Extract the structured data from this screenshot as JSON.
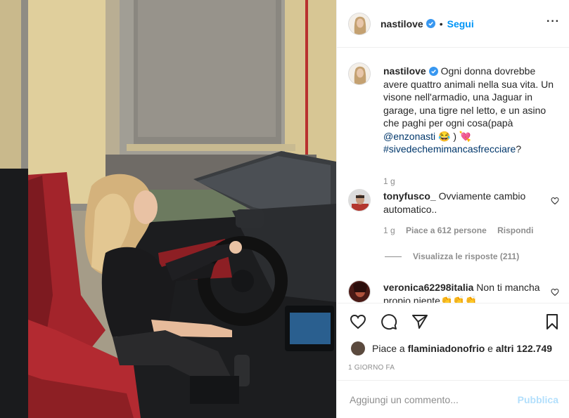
{
  "post": {
    "image_alt": "Woman seated in a red-leather convertible Jaguar",
    "author": {
      "username": "nastilove",
      "verified": true,
      "follow_label": "Segui",
      "dot": "•"
    },
    "more_icon": "more-horizontal-icon",
    "caption": {
      "username": "nastilove",
      "text_before_mention": " Ogni donna dovrebbe avere quattro animali nella sua vita. Un visone nell'armadio, una Jaguar in garage, una tigre nel letto, e un asino che paghi per ogni cosa(papà ",
      "mention": "@enzonasti",
      "text_after_mention": " 😂 ) 💘 ",
      "hashtag": "#sivedechemimancasfrecciare",
      "text_end": "?",
      "time": "1 g"
    },
    "comments": [
      {
        "username": "tonyfusco_",
        "text": " Ovviamente cambio automatico..",
        "time": "1 g",
        "likes": "Piace a 612 persone",
        "reply": "Rispondi",
        "view_replies": "Visualizza le risposte (211)"
      },
      {
        "username": "veronica62298italia",
        "text": " Non ti mancha propio niente👏👏👏"
      }
    ],
    "actions": {
      "like_icon": "heart-icon",
      "comment_icon": "comment-icon",
      "share_icon": "paper-plane-icon",
      "save_icon": "bookmark-icon"
    },
    "likes": {
      "prefix": "Piace a ",
      "user": "flaminiadonofrio",
      "middle": " e ",
      "others": "altri 122.749"
    },
    "date": "1 GIORNO FA",
    "add_comment": {
      "placeholder": "Aggiungi un commento...",
      "post_label": "Pubblica"
    },
    "colors": {
      "link_blue": "#0095f6",
      "mention_blue": "#00376b",
      "muted": "#8e8e8e",
      "border": "#efefef",
      "post_disabled": "#b2dffc"
    }
  }
}
